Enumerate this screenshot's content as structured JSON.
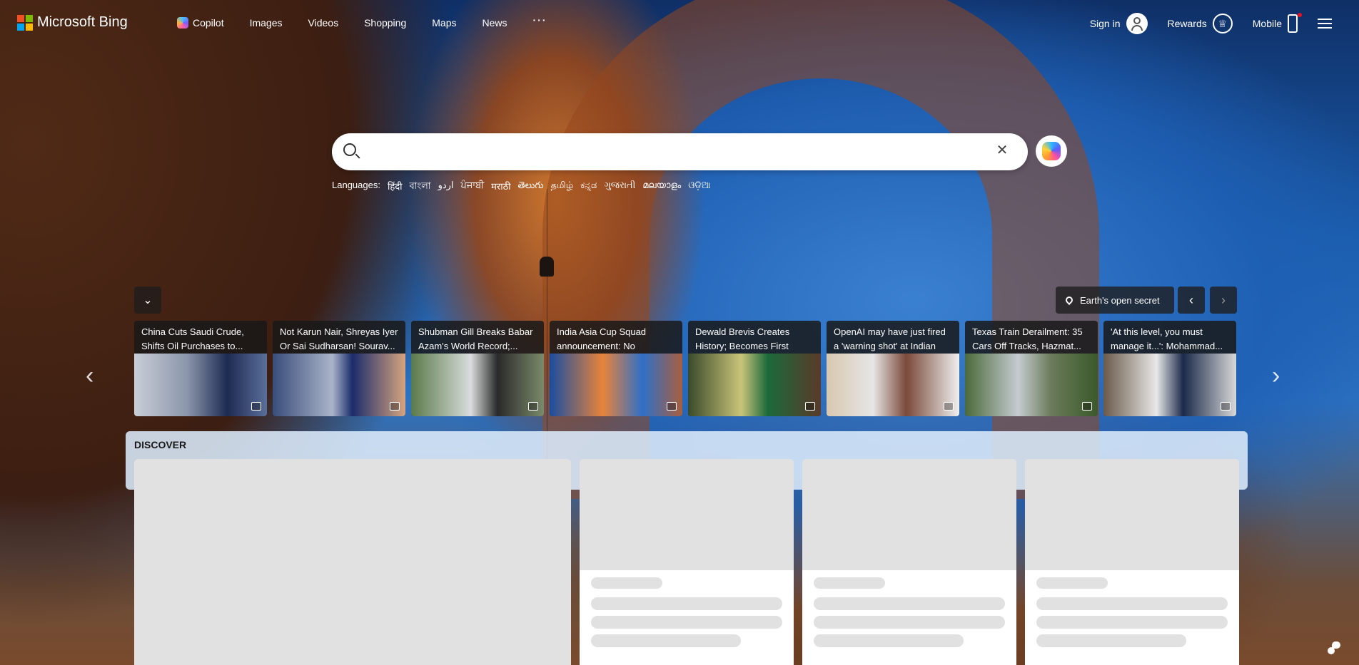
{
  "brand": {
    "name": "Microsoft Bing"
  },
  "nav": {
    "items": [
      {
        "label": "Copilot",
        "icon": "copilot-icon"
      },
      {
        "label": "Images"
      },
      {
        "label": "Videos"
      },
      {
        "label": "Shopping"
      },
      {
        "label": "Maps"
      },
      {
        "label": "News"
      }
    ],
    "more": "···"
  },
  "right_nav": {
    "signin": "Sign in",
    "rewards": "Rewards",
    "mobile": "Mobile",
    "menu_icon": "hamburger-icon"
  },
  "search": {
    "value": "",
    "placeholder": "",
    "clear": "✕"
  },
  "languages": {
    "label": "Languages:",
    "items": [
      "हिंदी",
      "বাংলা",
      "اردو",
      "ਪੰਜਾਬੀ",
      "मराठी",
      "తెలుగు",
      "தமிழ்",
      "ಕನ್ನಡ",
      "ગુજરાતી",
      "മലയാളം",
      "ଓଡ଼ିଆ"
    ]
  },
  "image_info": {
    "location_label": "Earth's open secret"
  },
  "carousel": {
    "collapse": "⌄",
    "prev": "‹",
    "next": "›",
    "cards": [
      {
        "title": "China Cuts Saudi Crude, Shifts Oil Purchases to..."
      },
      {
        "title": "Not Karun Nair, Shreyas Iyer Or Sai Sudharsan! Sourav..."
      },
      {
        "title": "Shubman Gill Breaks Babar Azam's World Record;..."
      },
      {
        "title": "India Asia Cup Squad announcement: No Yashas..."
      },
      {
        "title": "Dewald Brevis Creates History; Becomes First Play..."
      },
      {
        "title": "OpenAI may have just fired a 'warning shot' at Indian IT..."
      },
      {
        "title": "Texas Train Derailment: 35 Cars Off Tracks, Hazmat..."
      },
      {
        "title": "'At this level, you must manage it...': Mohammad..."
      }
    ]
  },
  "discover": {
    "title": "DISCOVER"
  },
  "colors": {
    "accent": "#ffffff",
    "discover_bg": "#dcebfa",
    "skeleton": "#e1e1e1"
  }
}
